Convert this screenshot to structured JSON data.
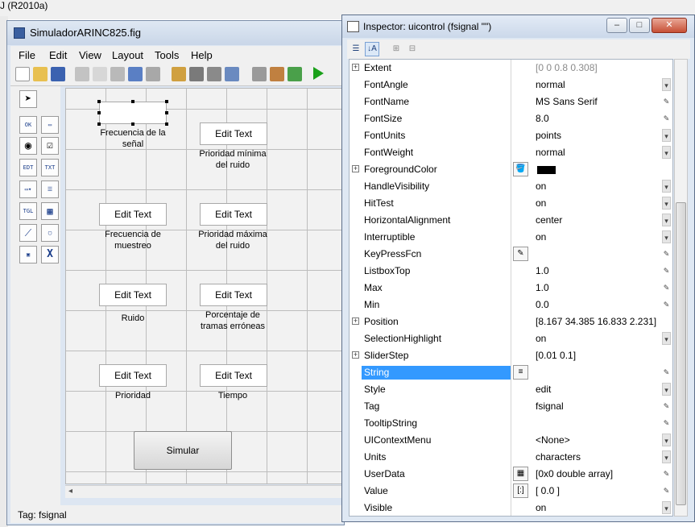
{
  "background": {
    "title": "J (R2010a)"
  },
  "guide": {
    "title": "SimuladorARINC825.fig",
    "menu": [
      "File",
      "Edit",
      "View",
      "Layout",
      "Tools",
      "Help"
    ],
    "controls": [
      {
        "edit": "",
        "label": "Frecuencia de la\nseñal"
      },
      {
        "edit": "Edit Text",
        "label": "Prioridad mínima\ndel ruido"
      },
      {
        "edit": "Edit Text",
        "label": "Frecuencia de\nmuestreo"
      },
      {
        "edit": "Edit Text",
        "label": "Prioridad máxima\ndel ruido"
      },
      {
        "edit": "Edit Text",
        "label": "Ruido"
      },
      {
        "edit": "Edit Text",
        "label": "Porcentaje de\ntramas erróneas"
      },
      {
        "edit": "Edit Text",
        "label": "Prioridad"
      },
      {
        "edit": "Edit Text",
        "label": "Tiempo"
      }
    ],
    "button": "Simular",
    "status": "Tag: fsignal",
    "palette": [
      "arrow-icon",
      "OK",
      "slider",
      "radio",
      "check",
      "EDT",
      "TXT",
      "popup",
      "listbox",
      "TGL",
      "table",
      "axes",
      "panel",
      "group",
      "activex"
    ]
  },
  "inspector": {
    "title": "Inspector:  uicontrol (fsignal \"\")",
    "rows": [
      {
        "name": "Extent",
        "value": "[0 0 0.8 0.308]",
        "exp": true,
        "dim": true
      },
      {
        "name": "FontAngle",
        "value": "normal",
        "btn": "drop"
      },
      {
        "name": "FontName",
        "value": "MS Sans Serif",
        "btn": "edit"
      },
      {
        "name": "FontSize",
        "value": "8.0",
        "btn": "edit"
      },
      {
        "name": "FontUnits",
        "value": "points",
        "btn": "drop"
      },
      {
        "name": "FontWeight",
        "value": "normal",
        "btn": "drop"
      },
      {
        "name": "ForegroundColor",
        "value": "",
        "exp": true,
        "icon": "paint-bucket-icon",
        "swatch": true
      },
      {
        "name": "HandleVisibility",
        "value": "on",
        "btn": "drop"
      },
      {
        "name": "HitTest",
        "value": "on",
        "btn": "drop"
      },
      {
        "name": "HorizontalAlignment",
        "value": "center",
        "btn": "drop"
      },
      {
        "name": "Interruptible",
        "value": "on",
        "btn": "drop"
      },
      {
        "name": "KeyPressFcn",
        "value": "",
        "icon": "pencil-icon",
        "btn": "edit"
      },
      {
        "name": "ListboxTop",
        "value": "1.0",
        "btn": "edit"
      },
      {
        "name": "Max",
        "value": "1.0",
        "btn": "edit"
      },
      {
        "name": "Min",
        "value": "0.0",
        "btn": "edit"
      },
      {
        "name": "Position",
        "value": "[8.167 34.385 16.833 2.231]",
        "exp": true
      },
      {
        "name": "SelectionHighlight",
        "value": "on",
        "btn": "drop"
      },
      {
        "name": "SliderStep",
        "value": "[0.01 0.1]",
        "exp": true
      },
      {
        "name": "String",
        "value": "",
        "icon": "text-icon",
        "btn": "edit",
        "sel": true
      },
      {
        "name": "Style",
        "value": "edit",
        "btn": "drop"
      },
      {
        "name": "Tag",
        "value": "fsignal",
        "btn": "edit"
      },
      {
        "name": "TooltipString",
        "value": "",
        "btn": "edit"
      },
      {
        "name": "UIContextMenu",
        "value": "<None>",
        "btn": "drop"
      },
      {
        "name": "Units",
        "value": "characters",
        "btn": "drop"
      },
      {
        "name": "UserData",
        "value": "[0x0  double array]",
        "icon": "grid-icon",
        "btn": "edit"
      },
      {
        "name": "Value",
        "value": "[ 0.0 ]",
        "icon": "array-icon",
        "btn": "edit"
      },
      {
        "name": "Visible",
        "value": "on",
        "btn": "drop"
      }
    ]
  },
  "colors": {
    "selection": "#3399ff",
    "title_gradient": "#cbd8ea"
  }
}
